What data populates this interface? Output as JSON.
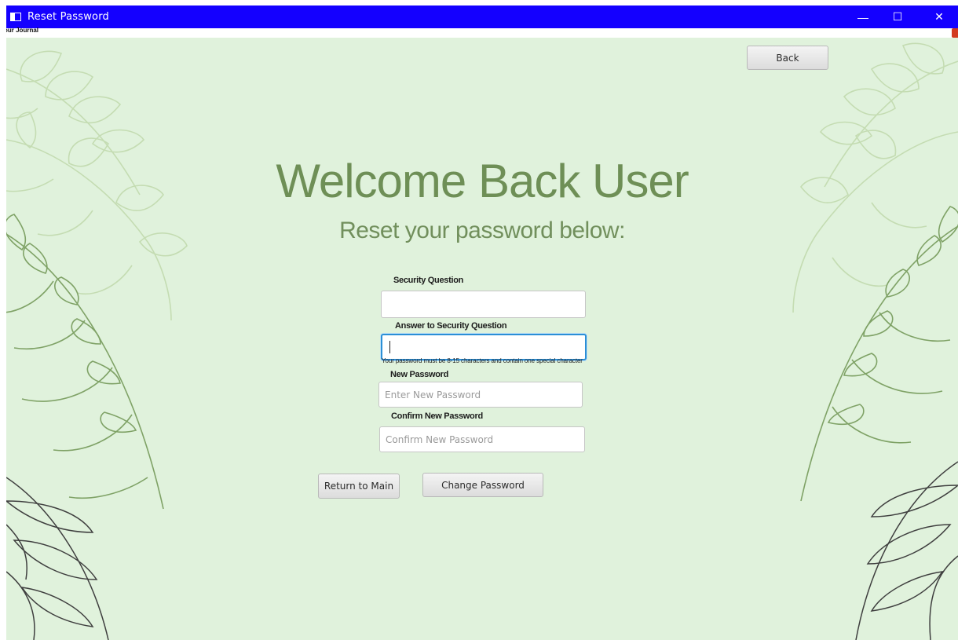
{
  "window": {
    "title": "Reset Password",
    "menu_text": "our Journal",
    "controls": {
      "minimize_glyph": "—",
      "maximize_glyph": "☐",
      "close_glyph": "✕"
    },
    "titlebar_color": "#1400ff"
  },
  "page": {
    "heading": "Welcome Back User",
    "subheading": "Reset your password below:",
    "back_button": "Back",
    "background_color": "#e0f2dc",
    "heading_color": "#6e8f56"
  },
  "form": {
    "security_question": {
      "label": "Security Question",
      "value": "",
      "placeholder": ""
    },
    "security_answer": {
      "label": "Answer to Security Question",
      "value": "",
      "placeholder": "",
      "focused": true
    },
    "password_hint": "Your password must be 8-15 characters and contain one special character",
    "new_password": {
      "label": "New Password",
      "placeholder": "Enter New Password"
    },
    "confirm_password": {
      "label": "Confirm New Password",
      "placeholder": "Confirm New Password"
    }
  },
  "actions": {
    "return_button": "Return to Main",
    "change_button": "Change Password"
  },
  "icons": {
    "app": "app-window-icon",
    "decoration": "fern-leaf-icon"
  }
}
